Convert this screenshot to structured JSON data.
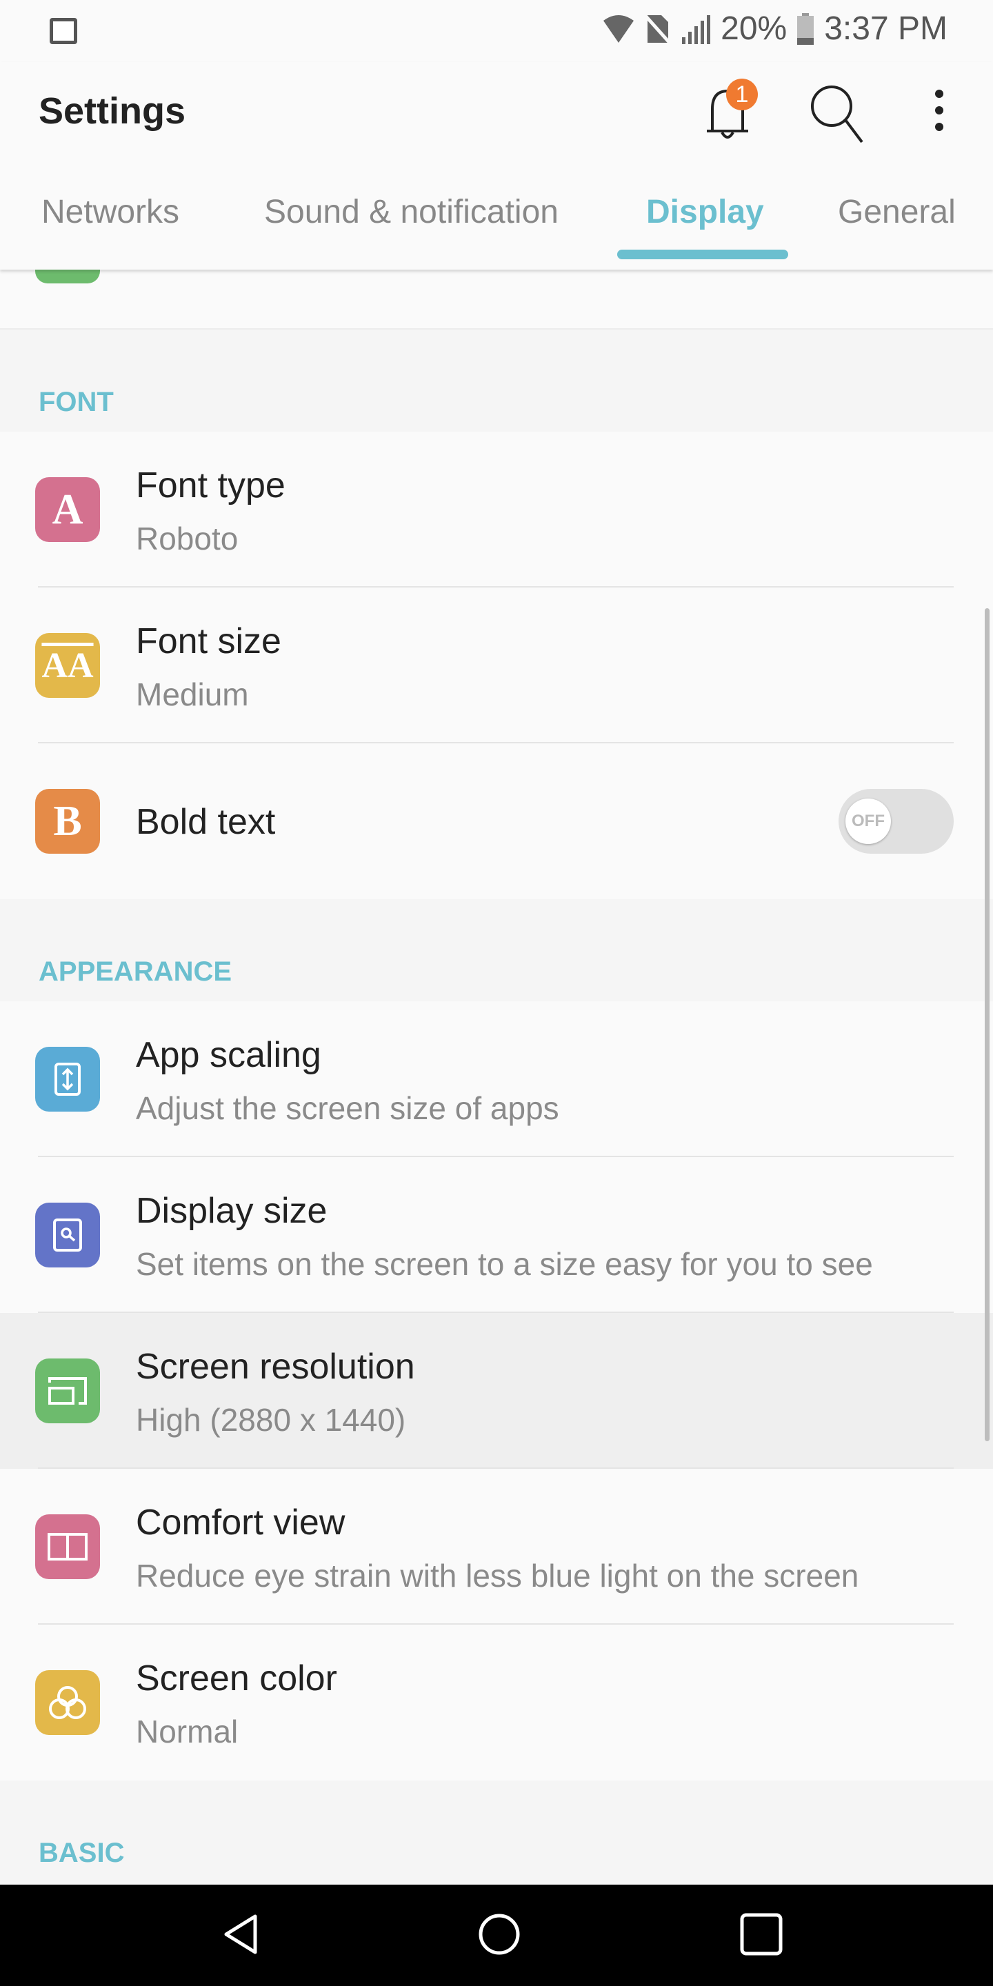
{
  "status_bar": {
    "battery": "20%",
    "time": "3:37 PM",
    "icons": [
      "gallery-icon",
      "wifi-icon",
      "no-sim-icon",
      "signal-icon",
      "battery-icon"
    ]
  },
  "app_bar": {
    "title": "Settings",
    "notification_count": "1"
  },
  "tabs": [
    {
      "label": "Networks"
    },
    {
      "label": "Sound & notification"
    },
    {
      "label": "Display",
      "active": true
    },
    {
      "label": "General"
    }
  ],
  "accent_color": "#6bbfcf",
  "sections": [
    {
      "header": "FONT",
      "items": [
        {
          "title": "Font type",
          "subtitle": "Roboto",
          "icon": "A",
          "color": "#d4718f"
        },
        {
          "title": "Font size",
          "subtitle": "Medium",
          "icon": "A",
          "color": "#e3b84a"
        },
        {
          "title": "Bold text",
          "icon": "B",
          "color": "#e58b48",
          "toggle": "OFF"
        }
      ]
    },
    {
      "header": "APPEARANCE",
      "items": [
        {
          "title": "App scaling",
          "subtitle": "Adjust the screen size of apps",
          "color": "#5aabd6"
        },
        {
          "title": "Display size",
          "subtitle": "Set items on the screen to a size easy for you to see",
          "color": "#6374c8"
        },
        {
          "title": "Screen resolution",
          "subtitle": "High (2880 x 1440)",
          "color": "#6dbb6d"
        },
        {
          "title": "Comfort view",
          "subtitle": "Reduce eye strain with less blue light on the screen",
          "color": "#d4718f"
        },
        {
          "title": "Screen color",
          "subtitle": "Normal",
          "color": "#e3b84a"
        }
      ]
    },
    {
      "header": "BASIC"
    }
  ]
}
